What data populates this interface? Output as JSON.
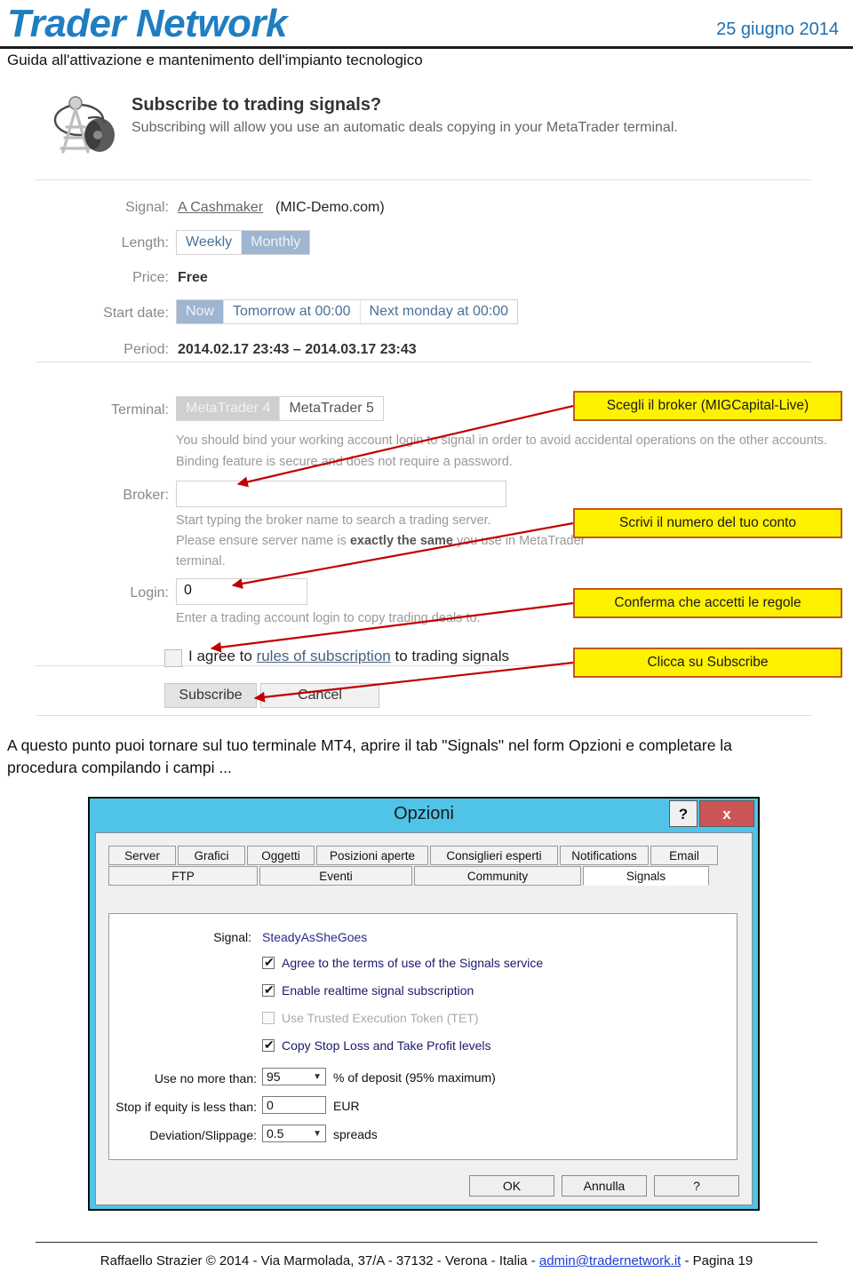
{
  "header": {
    "brand": "Trader Network",
    "date": "25 giugno 2014",
    "subtitle": "Guida all'attivazione e mantenimento dell'impianto tecnologico",
    "brand_color": "#1F7EC2"
  },
  "subscribe_form": {
    "icon": "radio-tower-icon",
    "title": "Subscribe to trading signals?",
    "subtitle": "Subscribing will allow you use an automatic deals copying in your MetaTrader terminal.",
    "signal_label": "Signal:",
    "signal_link": "A Cashmaker",
    "signal_suffix": "(MIC-Demo.com)",
    "length_label": "Length:",
    "length_options": [
      "Weekly",
      "Monthly"
    ],
    "length_selected": "Monthly",
    "price_label": "Price:",
    "price_value": "Free",
    "start_date_label": "Start date:",
    "start_date_options": [
      "Now",
      "Tomorrow at 00:00",
      "Next monday at 00:00"
    ],
    "start_date_selected": "Now",
    "period_label": "Period:",
    "period_value": "2014.02.17 23:43 – 2014.03.17 23:43",
    "terminal_label": "Terminal:",
    "terminal_options": [
      "MetaTrader 4",
      "MetaTrader 5"
    ],
    "terminal_selected": "MetaTrader 4",
    "bind_hint_1": "You should bind your working account login to signal in order to avoid accidental operations on the other accounts.",
    "bind_hint_2": "Binding feature is secure and does not require a password.",
    "broker_label": "Broker:",
    "broker_value": "",
    "broker_hint_1": "Start typing the broker name to search a trading server.",
    "broker_hint_2a": "Please ensure server name is ",
    "broker_hint_2b": "exactly the same",
    "broker_hint_2c": " you use in MetaTrader",
    "broker_hint_3": "terminal.",
    "login_label": "Login:",
    "login_value": "0",
    "login_hint": "Enter a trading account login to copy trading deals to.",
    "agree_pre": "I agree to ",
    "agree_link": "rules of subscription",
    "agree_post": " to trading signals",
    "agree_checked": false,
    "subscribe_button": "Subscribe",
    "cancel_button": "Cancel"
  },
  "annotations": [
    {
      "text": "Scegli il broker (MIGCapital-Live)"
    },
    {
      "text": "Scrivi il numero del tuo conto"
    },
    {
      "text": "Conferma che accetti le regole"
    },
    {
      "text": "Clicca su Subscribe"
    }
  ],
  "annotation_style": {
    "fill": "#FFF200",
    "border": "#C55A11",
    "arrow": "#C00000"
  },
  "mid_paragraph": "A questo punto puoi tornare sul tuo terminale MT4, aprire il tab \"Signals\" nel form Opzioni e completare la procedura compilando i campi ...",
  "options_dialog": {
    "title": "Opzioni",
    "help_button": "?",
    "close_button": "x",
    "tabs_row1": [
      "Server",
      "Grafici",
      "Oggetti",
      "Posizioni aperte",
      "Consiglieri esperti",
      "Notifications",
      "Email"
    ],
    "tabs_row2": [
      "FTP",
      "Eventi",
      "Community",
      "Signals"
    ],
    "active_tab": "Signals",
    "signal_label": "Signal:",
    "signal_value": "SteadyAsSheGoes",
    "checkboxes": [
      {
        "label": "Agree to the terms of use of the Signals service",
        "checked": true,
        "disabled": false
      },
      {
        "label": "Enable realtime signal subscription",
        "checked": true,
        "disabled": false
      },
      {
        "label": "Use Trusted Execution Token (TET)",
        "checked": false,
        "disabled": true
      },
      {
        "label": "Copy Stop Loss and Take Profit levels",
        "checked": true,
        "disabled": false
      }
    ],
    "fields": [
      {
        "label": "Use no more than:",
        "value": "95",
        "suffix": "% of deposit (95% maximum)",
        "type": "select"
      },
      {
        "label": "Stop if equity is less than:",
        "value": "0",
        "suffix": "EUR",
        "type": "input"
      },
      {
        "label": "Deviation/Slippage:",
        "value": "0.5",
        "suffix": "spreads",
        "type": "select"
      }
    ],
    "buttons": [
      "OK",
      "Annulla",
      "?"
    ]
  },
  "footer": {
    "pre": "Raffaello Strazier © 2014 - Via Marmolada, 37/A - 37132 - Verona - Italia - ",
    "email": "admin@tradernetwork.it",
    "post": " - Pagina 19"
  }
}
